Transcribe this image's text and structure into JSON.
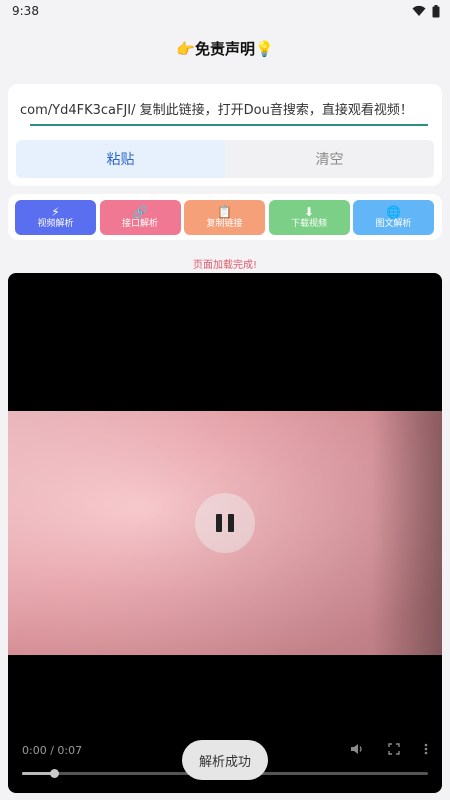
{
  "status_bar": {
    "time": "9:38",
    "wifi_icon": "wifi-icon",
    "battery_icon": "battery-icon"
  },
  "header": {
    "title": "👉免责声明💡"
  },
  "input": {
    "value": "com/Yd4FK3caFJI/ 复制此链接，打开Dou音搜索，直接观看视频！"
  },
  "buttons": {
    "paste": "粘贴",
    "clear": "清空"
  },
  "actions": [
    {
      "icon": "⚡",
      "icon_name": "lightning-icon",
      "label": "视频解析"
    },
    {
      "icon": "🔗",
      "icon_name": "link-icon",
      "label": "接口解析"
    },
    {
      "icon": "📋",
      "icon_name": "clipboard-icon",
      "label": "复制链接"
    },
    {
      "icon": "⬇",
      "icon_name": "download-icon",
      "label": "下载视频"
    },
    {
      "icon": "🌐",
      "icon_name": "globe-icon",
      "label": "图文解析"
    }
  ],
  "status_message": "页面加载完成!",
  "player": {
    "time": "0:00 / 0:07",
    "progress": 0.08
  },
  "toast": "解析成功",
  "colors": {
    "accent": "#2f66c9",
    "status": "#e05a6c"
  }
}
